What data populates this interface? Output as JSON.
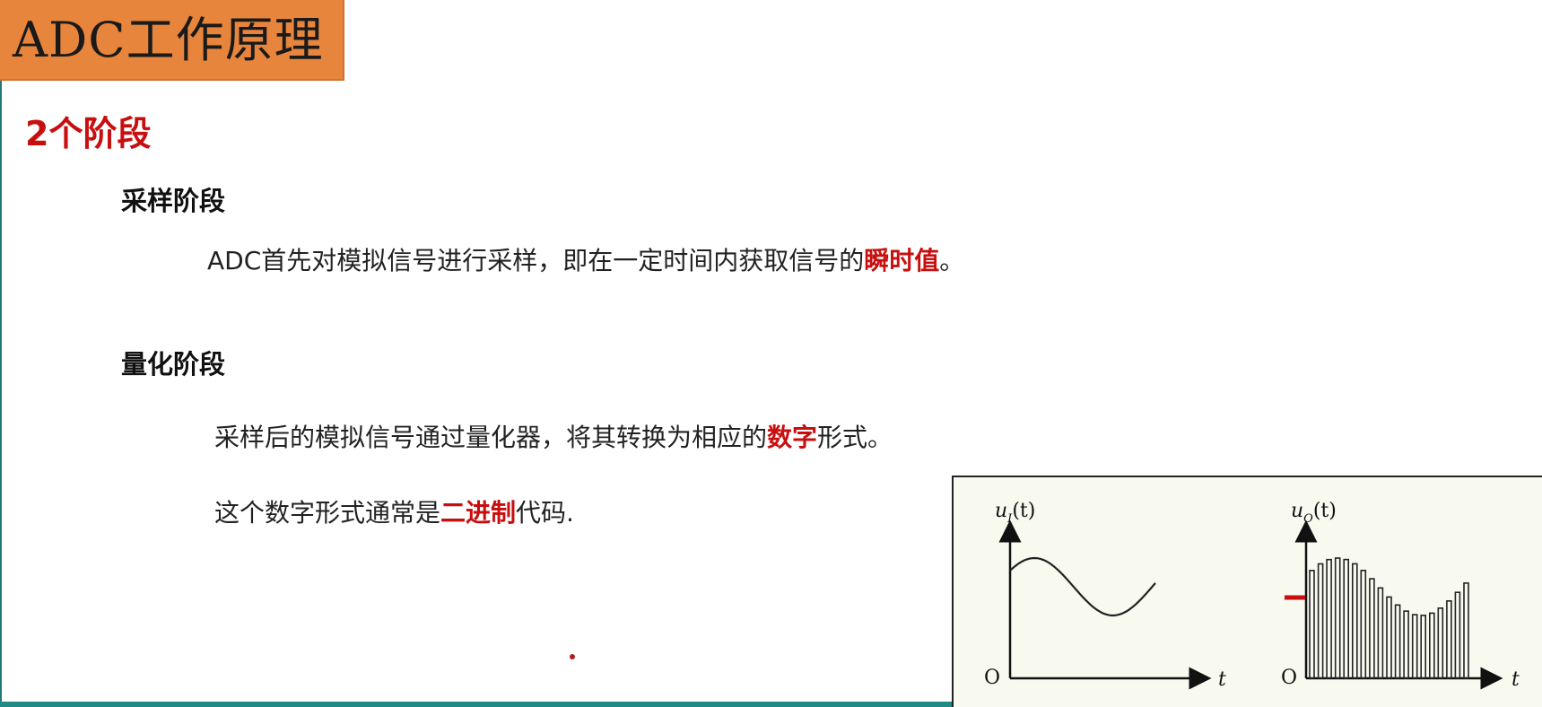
{
  "header": {
    "title": "ADC工作原理"
  },
  "section": {
    "title": "2个阶段"
  },
  "sampling": {
    "title": "采样阶段",
    "text_before": "ADC首先对模拟信号进行采样，即在一定时间内获取信号的",
    "highlight": "瞬时值",
    "text_after": "。"
  },
  "quantization": {
    "title": "量化阶段",
    "line1_before": "采样后的模拟信号通过量化器，将其转换为相应的",
    "line1_highlight": "数字",
    "line1_after": "形式。",
    "line2_before": "这个数字形式通常是",
    "line2_highlight": "二进制",
    "line2_after": "代码."
  },
  "figure": {
    "left_plot": {
      "y_label": "u",
      "y_sub": "I",
      "y_arg": "(t)",
      "x_label": "t",
      "origin": "O"
    },
    "right_plot": {
      "y_label": "u",
      "y_sub": "O",
      "y_arg": "(t)",
      "x_label": "t",
      "origin": "O"
    }
  },
  "colors": {
    "title_bg": "#e8853d",
    "highlight": "#c80f0f",
    "accent_line": "#1f7a78"
  }
}
